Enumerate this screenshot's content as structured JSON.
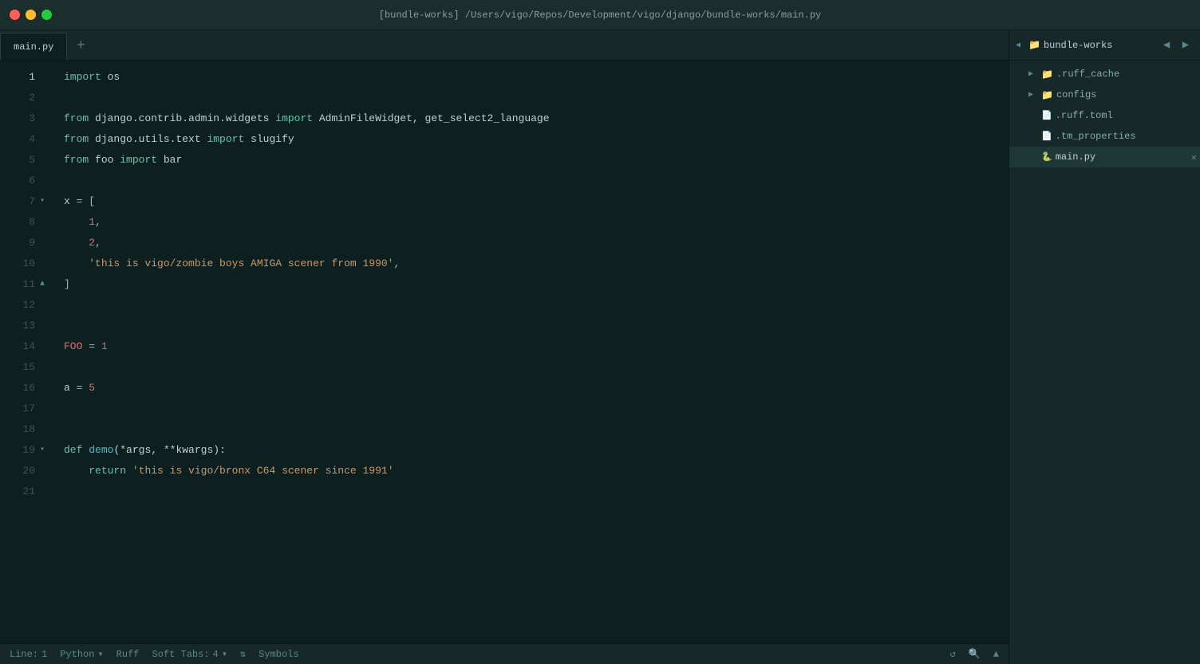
{
  "titleBar": {
    "title": "[bundle-works]  /Users/vigo/Repos/Development/vigo/django/bundle-works/main.py"
  },
  "tabs": [
    {
      "label": "main.py",
      "active": true
    }
  ],
  "tabAdd": "+",
  "codeLines": [
    {
      "num": 1,
      "content": [
        {
          "text": "import",
          "cls": "kw-import"
        },
        {
          "text": " os",
          "cls": "identifier"
        }
      ]
    },
    {
      "num": 2,
      "content": []
    },
    {
      "num": 3,
      "content": [
        {
          "text": "from",
          "cls": "kw-from"
        },
        {
          "text": " django.contrib.admin.widgets ",
          "cls": "module"
        },
        {
          "text": "import",
          "cls": "kw-import"
        },
        {
          "text": " AdminFileWidget, get_select2_language",
          "cls": "identifier"
        }
      ]
    },
    {
      "num": 4,
      "content": [
        {
          "text": "from",
          "cls": "kw-from"
        },
        {
          "text": " django.utils.text ",
          "cls": "module"
        },
        {
          "text": "import",
          "cls": "kw-import"
        },
        {
          "text": " slugify",
          "cls": "identifier"
        }
      ]
    },
    {
      "num": 5,
      "content": [
        {
          "text": "from",
          "cls": "kw-from"
        },
        {
          "text": " foo ",
          "cls": "module"
        },
        {
          "text": "import",
          "cls": "kw-import"
        },
        {
          "text": " bar",
          "cls": "identifier"
        }
      ]
    },
    {
      "num": 6,
      "content": []
    },
    {
      "num": 7,
      "content": [
        {
          "text": "x",
          "cls": "identifier"
        },
        {
          "text": " = [",
          "cls": "punctuation"
        }
      ],
      "fold": "▾"
    },
    {
      "num": 8,
      "content": [
        {
          "text": "    ",
          "cls": ""
        },
        {
          "text": "1",
          "cls": "number"
        },
        {
          "text": ",",
          "cls": "punctuation"
        }
      ]
    },
    {
      "num": 9,
      "content": [
        {
          "text": "    ",
          "cls": ""
        },
        {
          "text": "2",
          "cls": "number"
        },
        {
          "text": ",",
          "cls": "punctuation"
        }
      ]
    },
    {
      "num": 10,
      "content": [
        {
          "text": "    ",
          "cls": ""
        },
        {
          "text": "'this is vigo/zombie boys AMIGA scener from 1990'",
          "cls": "string"
        },
        {
          "text": ",",
          "cls": "punctuation"
        }
      ]
    },
    {
      "num": 11,
      "content": [
        {
          "text": "]",
          "cls": "punctuation"
        }
      ],
      "fold": "▲"
    },
    {
      "num": 12,
      "content": []
    },
    {
      "num": 13,
      "content": []
    },
    {
      "num": 14,
      "content": [
        {
          "text": "FOO",
          "cls": "var-red"
        },
        {
          "text": " = ",
          "cls": "punctuation"
        },
        {
          "text": "1",
          "cls": "number"
        }
      ]
    },
    {
      "num": 15,
      "content": []
    },
    {
      "num": 16,
      "content": [
        {
          "text": "a",
          "cls": "identifier"
        },
        {
          "text": " = ",
          "cls": "punctuation"
        },
        {
          "text": "5",
          "cls": "number"
        }
      ]
    },
    {
      "num": 17,
      "content": []
    },
    {
      "num": 18,
      "content": []
    },
    {
      "num": 19,
      "content": [
        {
          "text": "def",
          "cls": "kw-def"
        },
        {
          "text": " ",
          "cls": ""
        },
        {
          "text": "demo",
          "cls": "func-name"
        },
        {
          "text": "(*args, **kwargs):",
          "cls": "param"
        }
      ],
      "fold": "▾"
    },
    {
      "num": 20,
      "content": [
        {
          "text": "    ",
          "cls": ""
        },
        {
          "text": "return",
          "cls": "kw-return"
        },
        {
          "text": " ",
          "cls": ""
        },
        {
          "text": "'this is vigo/bronx C64 scener since 1991'",
          "cls": "string"
        }
      ]
    },
    {
      "num": 21,
      "content": []
    }
  ],
  "sidebar": {
    "title": "bundle-works",
    "items": [
      {
        "label": ".ruff_cache",
        "type": "folder",
        "indent": 1,
        "collapsed": true
      },
      {
        "label": "configs",
        "type": "folder",
        "indent": 1,
        "collapsed": true
      },
      {
        "label": ".ruff.toml",
        "type": "file-toml",
        "indent": 1
      },
      {
        "label": ".tm_properties",
        "type": "file",
        "indent": 1
      },
      {
        "label": "main.py",
        "type": "file-py",
        "indent": 1,
        "active": true,
        "closeable": true
      }
    ]
  },
  "statusBar": {
    "line": "Line:",
    "lineNum": "1",
    "language": "Python",
    "ruff": "Ruff",
    "softTabs": "Soft Tabs:",
    "tabSize": "4",
    "symbols": "Symbols"
  }
}
